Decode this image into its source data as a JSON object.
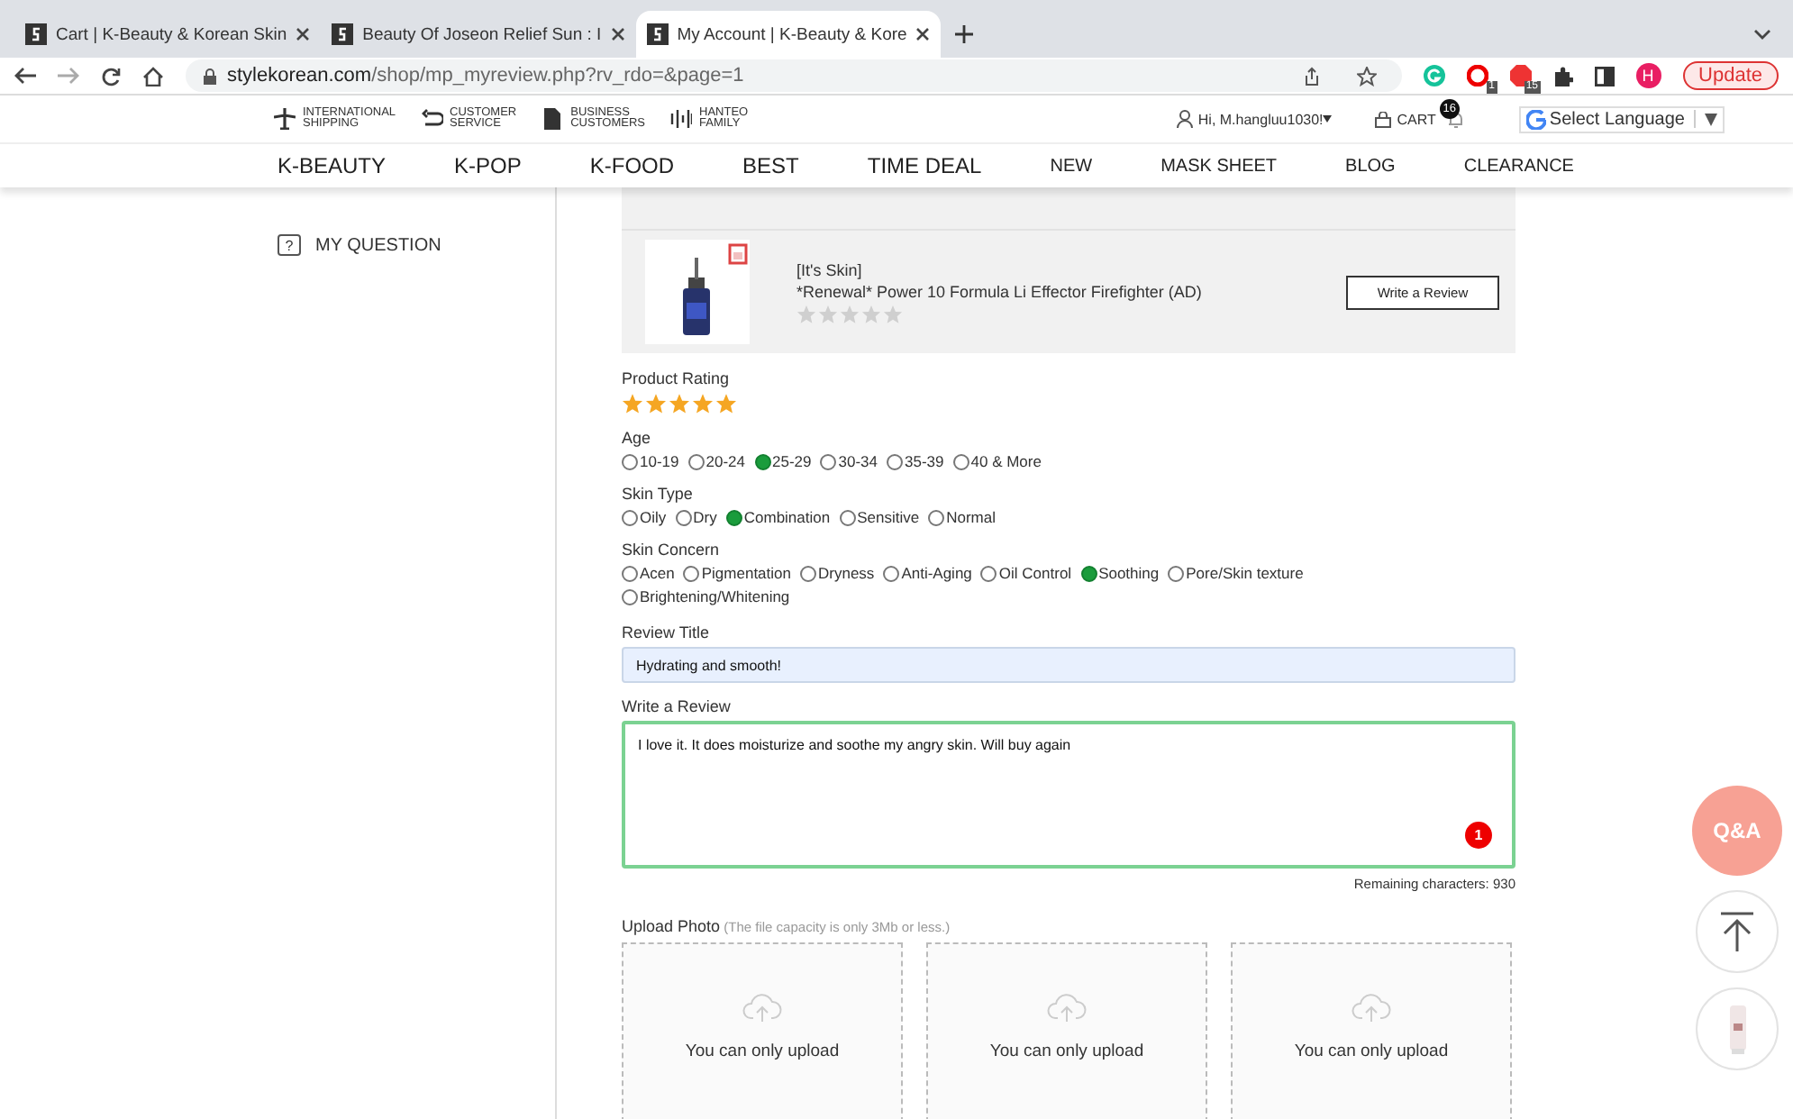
{
  "browser": {
    "tabs": [
      {
        "title": "Cart | K-Beauty & Korean Skin",
        "selected": false
      },
      {
        "title": "Beauty Of Joseon Relief Sun : I",
        "selected": false
      },
      {
        "title": "My Account | K-Beauty & Kore",
        "selected": true
      }
    ],
    "url_host": "stylekorean.com",
    "url_path": "/shop/mp_myreview.php?rv_rdo=&page=1",
    "extension_badges": [
      "1",
      "15"
    ],
    "profile": "H",
    "update_button": "Update"
  },
  "header": {
    "utility_links": [
      {
        "kind": "plane",
        "line1": "INTERNATIONAL",
        "line2": "SHIPPING"
      },
      {
        "kind": "return",
        "line1": "CUSTOMER",
        "line2": "SERVICE"
      },
      {
        "kind": "doc",
        "line1": "BUSINESS",
        "line2": "CUSTOMERS"
      },
      {
        "kind": "bars",
        "line1": "HANTEO",
        "line2": "FAMILY"
      }
    ],
    "user": "Hi, M.hangluu1030!",
    "cart": "CART",
    "cart_count": "16",
    "language": "Select Language",
    "nav": [
      "K-BEAUTY",
      "K-POP",
      "K-FOOD",
      "BEST",
      "TIME DEAL",
      "NEW",
      "MASK SHEET",
      "BLOG",
      "CLEARANCE"
    ]
  },
  "sidebar": {
    "items": [
      {
        "icon_text": "?",
        "label": "MY QUESTION"
      }
    ]
  },
  "product": {
    "brand": "[It's Skin]",
    "name": "*Renewal* Power 10 Formula Li Effector Firefighter (AD)",
    "stars": 0,
    "button": "Write a Review"
  },
  "form": {
    "rating_label": "Product Rating",
    "stars": 5,
    "groups": [
      {
        "label": "Age",
        "options": [
          {
            "label": "10-19",
            "selected": false
          },
          {
            "label": "20-24",
            "selected": false
          },
          {
            "label": "25-29",
            "selected": true
          },
          {
            "label": "30-34",
            "selected": false
          },
          {
            "label": "35-39",
            "selected": false
          },
          {
            "label": "40 & More",
            "selected": false
          }
        ]
      },
      {
        "label": "Skin Type",
        "options": [
          {
            "label": "Oily",
            "selected": false
          },
          {
            "label": "Dry",
            "selected": false
          },
          {
            "label": "Combination",
            "selected": true
          },
          {
            "label": "Sensitive",
            "selected": false
          },
          {
            "label": "Normal",
            "selected": false
          }
        ]
      },
      {
        "label": "Skin Concern",
        "options": [
          {
            "label": "Acen",
            "selected": false
          },
          {
            "label": "Pigmentation",
            "selected": false
          },
          {
            "label": "Dryness",
            "selected": false
          },
          {
            "label": "Anti-Aging",
            "selected": false
          },
          {
            "label": "Oil Control",
            "selected": false
          },
          {
            "label": "Soothing",
            "selected": true
          },
          {
            "label": "Pore/Skin texture",
            "selected": false
          },
          {
            "label": "Brightening/Whitening",
            "selected": false
          }
        ]
      }
    ],
    "title_label": "Review Title",
    "title_value": "Hydrating and smooth!",
    "review_label": "Write a Review",
    "review_value": "I love it. It does moisturize and soothe my angry skin. Will buy again",
    "grammar_badge": "1",
    "remaining": "Remaining characters: 930",
    "upload_label": "Upload Photo",
    "upload_note": "(The file capacity is only 3Mb or less.)",
    "upload_boxes": [
      "You can only upload",
      "You can only upload",
      "You can only upload"
    ]
  },
  "floating": {
    "qa": "Q&A"
  }
}
